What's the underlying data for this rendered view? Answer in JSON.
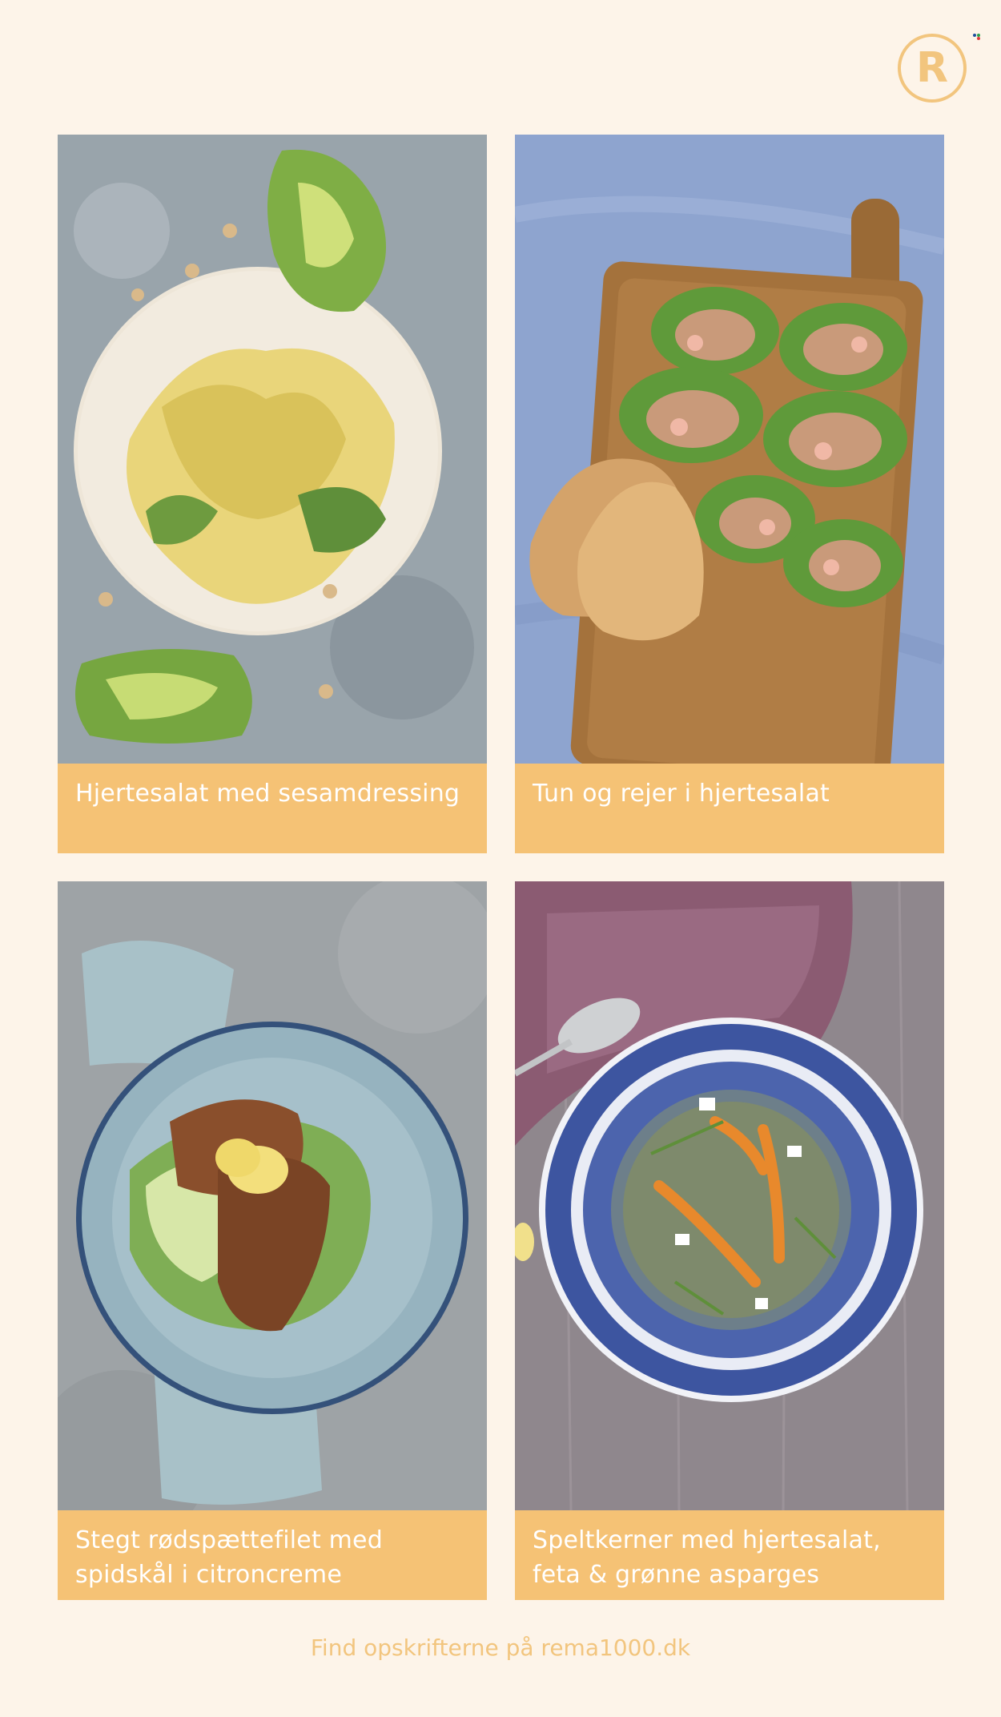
{
  "brand": {
    "logo_letter": "R",
    "accent_color": "#f5c275",
    "dot_colors": [
      "#1d4f9c",
      "#2ba14b",
      "#e03a3e"
    ]
  },
  "recipes": [
    {
      "title": "Hjertesalat med sesamdressing",
      "image_icon": "lettuce-salad-photo"
    },
    {
      "title": "Tun og rejer i hjertesalat",
      "image_icon": "shrimp-lettuce-cups-photo"
    },
    {
      "title": "Stegt rødspættefilet med spidskål i citroncreme",
      "image_icon": "fried-plaice-photo"
    },
    {
      "title": "Speltkerner med hjertesalat, feta & grønne asparges",
      "image_icon": "spelt-salad-photo"
    }
  ],
  "footer": {
    "text": "Find opskrifterne på rema1000.dk"
  }
}
